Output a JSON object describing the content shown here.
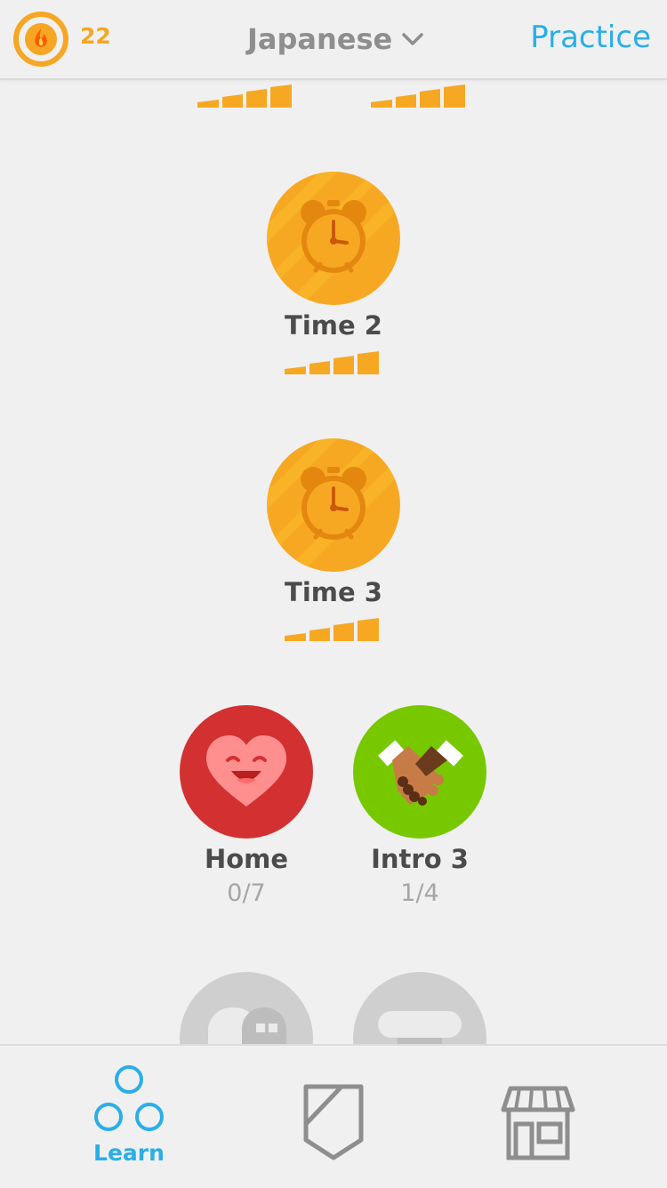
{
  "header": {
    "streak_count": "22",
    "language": "Japanese",
    "practice_label": "Practice"
  },
  "skills": [
    {
      "name": "Time 2",
      "strength": "full",
      "icon": "alarm-clock-icon"
    },
    {
      "name": "Time 3",
      "strength": "full",
      "icon": "alarm-clock-icon"
    },
    {
      "name": "Home",
      "progress": "0/7",
      "icon": "smiling-heart-icon"
    },
    {
      "name": "Intro 3",
      "progress": "1/4",
      "icon": "handshake-icon"
    }
  ],
  "tabs": {
    "learn_label": "Learn"
  },
  "colors": {
    "accent_blue": "#2aaee8",
    "gold": "#f7a823",
    "red": "#d33131",
    "green": "#78c800"
  }
}
